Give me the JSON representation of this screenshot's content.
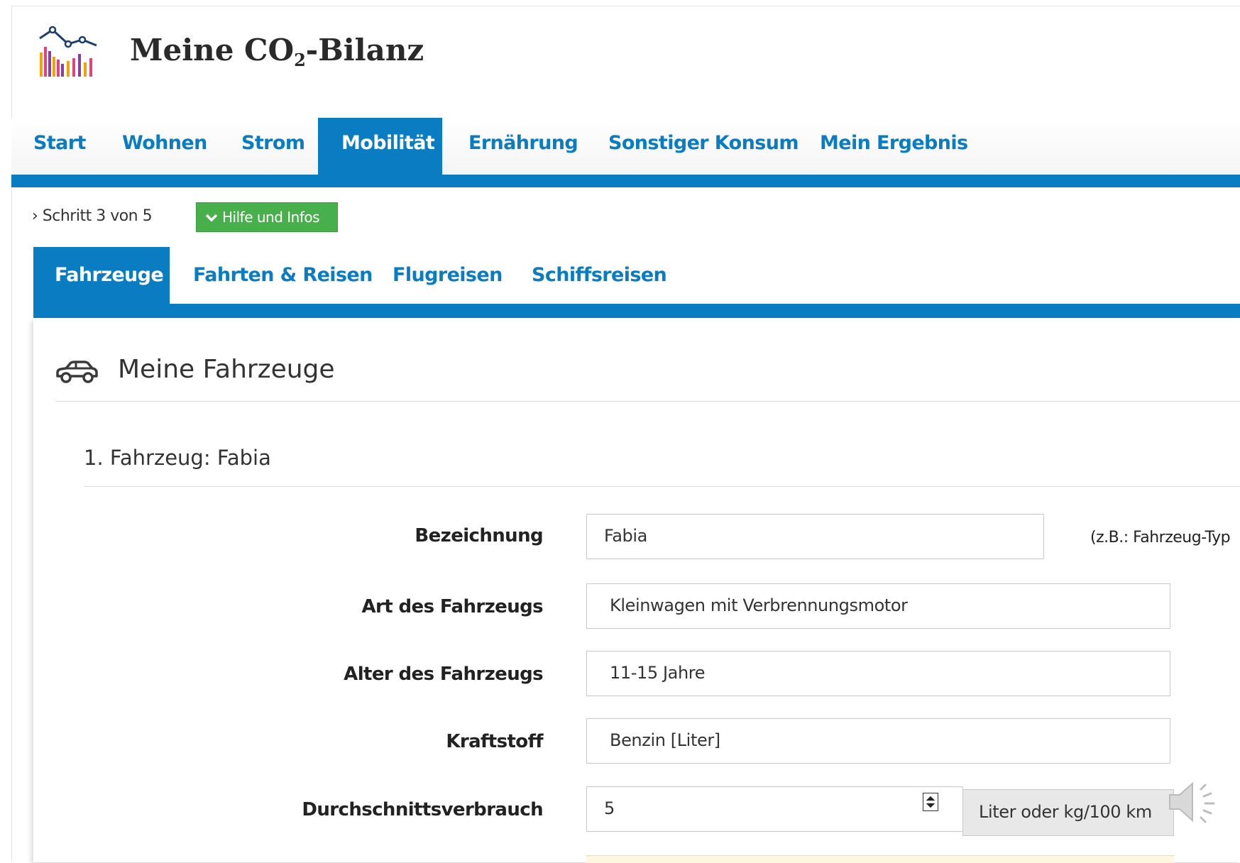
{
  "header": {
    "title_prefix": "Meine CO",
    "title_sub": "2",
    "title_suffix": "-Bilanz"
  },
  "main_nav": {
    "items": [
      {
        "label": "Start"
      },
      {
        "label": "Wohnen"
      },
      {
        "label": "Strom"
      },
      {
        "label": "Mobilität"
      },
      {
        "label": "Ernährung"
      },
      {
        "label": "Sonstiger Konsum"
      },
      {
        "label": "Mein Ergebnis"
      }
    ],
    "active": "Mobilität"
  },
  "step": {
    "text": "› Schritt 3 von 5",
    "help_label": "Hilfe und Infos"
  },
  "sub_nav": {
    "items": [
      {
        "label": "Fahrzeuge"
      },
      {
        "label": "Fahrten & Reisen"
      },
      {
        "label": "Flugreisen"
      },
      {
        "label": "Schiffsreisen"
      }
    ],
    "active": "Fahrzeuge"
  },
  "section": {
    "title": "Meine Fahrzeuge",
    "vehicle_title": "1. Fahrzeug: Fabia"
  },
  "form": {
    "bezeichnung_label": "Bezeichnung",
    "bezeichnung_value": "Fabia",
    "bezeichnung_hint": "(z.B.: Fahrzeug-Typ",
    "art_label": "Art des Fahrzeugs",
    "art_value": "Kleinwagen mit Verbrennungsmotor",
    "alter_label": "Alter des Fahrzeugs",
    "alter_value": "11-15 Jahre",
    "kraftstoff_label": "Kraftstoff",
    "kraftstoff_value": "Benzin [Liter]",
    "verbrauch_label": "Durchschnittsverbrauch",
    "verbrauch_value": "5",
    "verbrauch_unit": "Liter oder kg/100 km"
  },
  "colors": {
    "brand_blue": "#0a7cc1",
    "help_green": "#47b04b"
  },
  "icons": [
    "logo-chart-icon",
    "chevron-down-icon",
    "car-icon",
    "spinner-icon",
    "speaker-icon"
  ]
}
